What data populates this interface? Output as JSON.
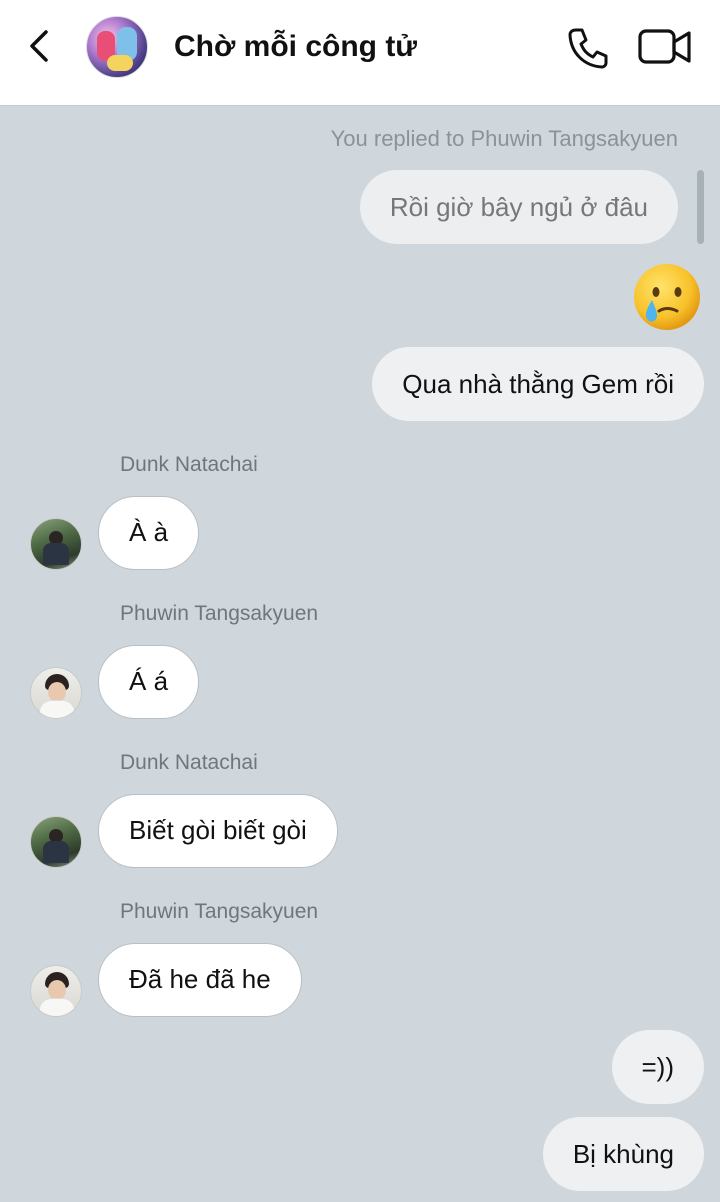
{
  "header": {
    "title": "Chờ mỗi công tử",
    "back_icon": "chevron-left-icon",
    "call_icon": "phone-icon",
    "video_icon": "video-camera-icon"
  },
  "conversation": {
    "reply_note": "You replied to Phuwin Tangsakyuen",
    "replied_message": "Rồi giờ bây ngủ ở đâu",
    "emoji": "crying-face-emoji",
    "outgoing_1": "Qua nhà thằng Gem rồi",
    "messages_in": [
      {
        "sender": "Dunk Natachai",
        "text": "À à"
      },
      {
        "sender": "Phuwin Tangsakyuen",
        "text": "Á á"
      },
      {
        "sender": "Dunk Natachai",
        "text": "Biết gòi biết gòi"
      },
      {
        "sender": "Phuwin Tangsakyuen",
        "text": "Đã he đã he"
      }
    ],
    "outgoing_2": "=))",
    "outgoing_3": "Bị khùng"
  },
  "colors": {
    "background": "#cfd7dd",
    "header_bg": "#ffffff",
    "incoming_bubble": "#ffffff",
    "outgoing_bubble": "#eef0f2"
  }
}
